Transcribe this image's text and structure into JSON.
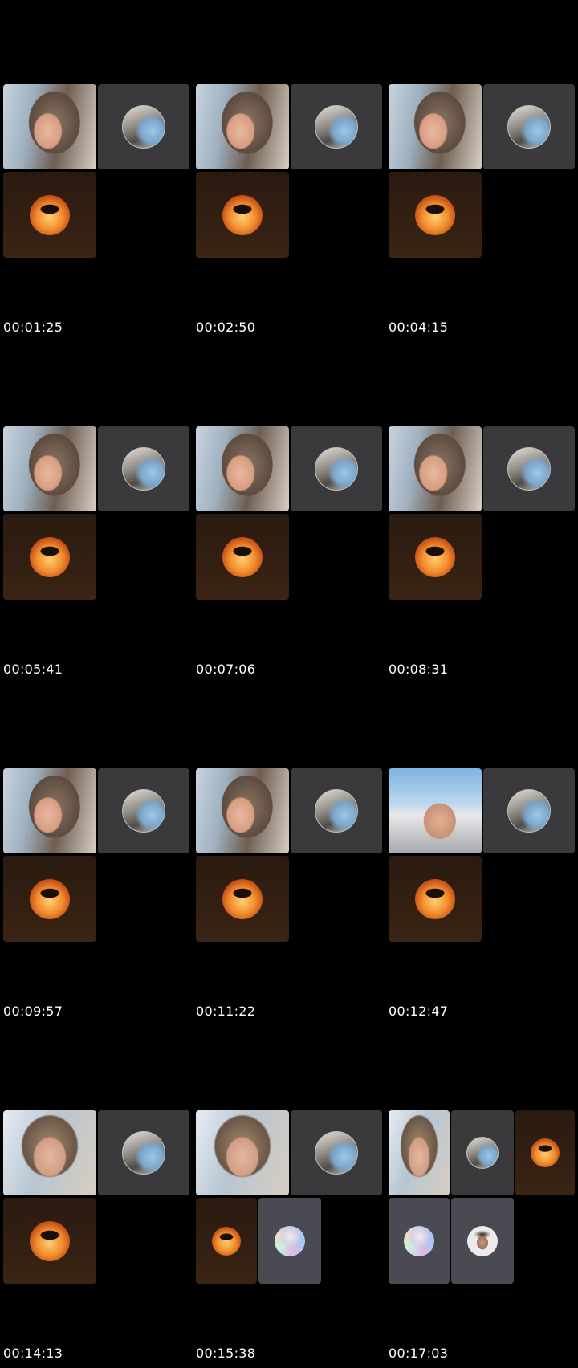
{
  "timestamps": [
    "00:01:25",
    "00:02:50",
    "00:04:15",
    "00:05:41",
    "00:07:06",
    "00:08:31",
    "00:09:57",
    "00:11:22",
    "00:12:47",
    "00:14:13",
    "00:15:38",
    "00:17:03"
  ],
  "colors": {
    "background": "#000000",
    "room_tile": "#3a3a3c",
    "participant_tile": "#4a4b52",
    "timestamp_text": "#ffffff"
  },
  "icons": [
    "avatar-room-icon",
    "avatar-flame-icon",
    "avatar-prism-icon",
    "avatar-man-icon"
  ]
}
